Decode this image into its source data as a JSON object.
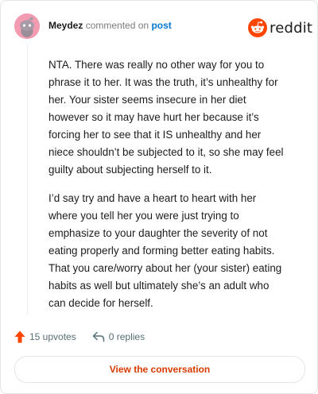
{
  "comment": {
    "author": "Meydez",
    "action_text": "commented on",
    "post_link": "post",
    "paragraphs": [
      "NTA. There was really no other way for you to phrase it to her. It was the truth, it’s unhealthy for her. Your sister seems insecure in her diet however so it may have hurt her because it’s forcing her to see that it IS unhealthy and her niece shouldn’t be subjected to it, so she may feel guilty about subjecting herself to it.",
      "I’d say try and have a heart to heart with her where you tell her you were just trying to emphasize to your daughter the severity of not eating properly and forming better eating habits. That you care/worry about her (your sister) eating habits as well but ultimately she’s an adult who can decide for herself."
    ],
    "upvotes": "15 upvotes",
    "replies": "0 replies"
  },
  "brand": {
    "name": "reddit",
    "color": "#ff4500"
  },
  "cta": {
    "label": "View the conversation"
  },
  "icons": {
    "avatar": "snoo-avatar",
    "upvote": "upvote-arrow-icon",
    "reply": "reply-arrow-icon",
    "logo": "reddit-snoo-icon"
  }
}
